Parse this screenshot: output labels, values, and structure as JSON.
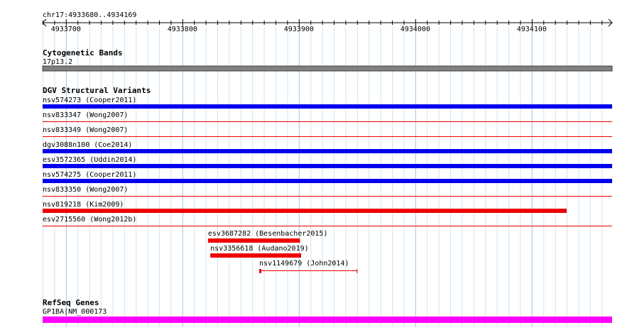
{
  "location": "chr17:4933680..4934169",
  "ruler": {
    "start": 4933680,
    "end": 4934169,
    "labels": [
      "4933700",
      "4933800",
      "4933900",
      "4934000",
      "4934100"
    ],
    "label_values": [
      4933700,
      4933800,
      4933900,
      4934000,
      4934100
    ]
  },
  "tracks": {
    "cytogenetic": {
      "title": "Cytogenetic Bands",
      "band_label": "17p13.2",
      "band_color": "#808080"
    },
    "dgv": {
      "title": "DGV Structural Variants",
      "variants": [
        {
          "label": "nsv574273 (Cooper2011)",
          "type": "gain",
          "extent": "full",
          "color": "#0000ee"
        },
        {
          "label": "nsv833347 (Wong2007)",
          "type": "loss",
          "extent": "full-line",
          "color": "#ee0000"
        },
        {
          "label": "nsv833349 (Wong2007)",
          "type": "loss",
          "extent": "full-line",
          "color": "#ee0000"
        },
        {
          "label": "dgv3088n100 (Coe2014)",
          "type": "gain",
          "extent": "full",
          "color": "#0000ee"
        },
        {
          "label": "esv3572365 (Uddin2014)",
          "type": "gain",
          "extent": "full",
          "color": "#0000ee"
        },
        {
          "label": "nsv574275 (Cooper2011)",
          "type": "gain",
          "extent": "full",
          "color": "#0000ee"
        },
        {
          "label": "nsv833350 (Wong2007)",
          "type": "loss",
          "extent": "full-line",
          "color": "#ee0000"
        },
        {
          "label": "nsv819218 (Kim2009)",
          "type": "loss",
          "extent": "partial",
          "end": 4934130,
          "color": "#ee0000"
        },
        {
          "label": "esv2715560 (Wong2012b)",
          "type": "loss",
          "extent": "full-line",
          "color": "#ee0000"
        }
      ],
      "small_variants": [
        {
          "label": "esv3687282 (Besenbacher2015)",
          "start": 4933822,
          "end": 4933901,
          "style": "bar",
          "color": "#ee0000"
        },
        {
          "label": "nsv3356618 (Audano2019)",
          "start": 4933824,
          "end": 4933902,
          "style": "bar",
          "color": "#ee0000"
        },
        {
          "label": "nsv1149679 (John2014)",
          "start": 4933866,
          "end": 4933950,
          "style": "line",
          "color": "#ee0000"
        }
      ]
    },
    "refseq": {
      "title": "RefSeq Genes",
      "gene_label": "GP1BA|NM_000173",
      "color": "#ff00ff"
    }
  }
}
